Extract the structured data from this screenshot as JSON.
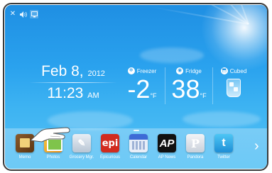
{
  "topbar": {
    "close_glyph": "✕",
    "volume_glyph": "🔊",
    "screen_glyph": "▭",
    "icons": [
      "close-icon",
      "volume-icon",
      "screen-icon"
    ]
  },
  "datetime": {
    "date": "Feb 8,",
    "year": "2012",
    "time": "11:23",
    "ampm": "AM"
  },
  "fridge_status": {
    "freezer": {
      "label": "Freezer",
      "value": "-2",
      "unit": "°F",
      "icon": "freezer-icon"
    },
    "fridge": {
      "label": "Fridge",
      "value": "38",
      "unit": "°F",
      "icon": "fridge-icon"
    },
    "ice": {
      "label": "Cubed",
      "icon": "ice-cubes-icon"
    }
  },
  "dock": {
    "apps": [
      {
        "label": "Memo",
        "icon": "memo-icon"
      },
      {
        "label": "Photos",
        "icon": "photos-icon"
      },
      {
        "label": "Grocery Mgr.",
        "icon": "grocery-icon"
      },
      {
        "label": "Epicurious",
        "icon": "epicurious-icon",
        "glyph": "epi"
      },
      {
        "label": "Calendar",
        "icon": "calendar-icon"
      },
      {
        "label": "AP News",
        "icon": "ap-news-icon",
        "glyph": "AP"
      },
      {
        "label": "Pandora",
        "icon": "pandora-icon",
        "glyph": "P"
      },
      {
        "label": "Twitter",
        "icon": "twitter-icon",
        "glyph": "t"
      }
    ],
    "next_glyph": "›"
  },
  "colors": {
    "sky_top": "#1f8fe3",
    "sky_bottom": "#55c1f5",
    "bezel": "#3b3b3b"
  }
}
